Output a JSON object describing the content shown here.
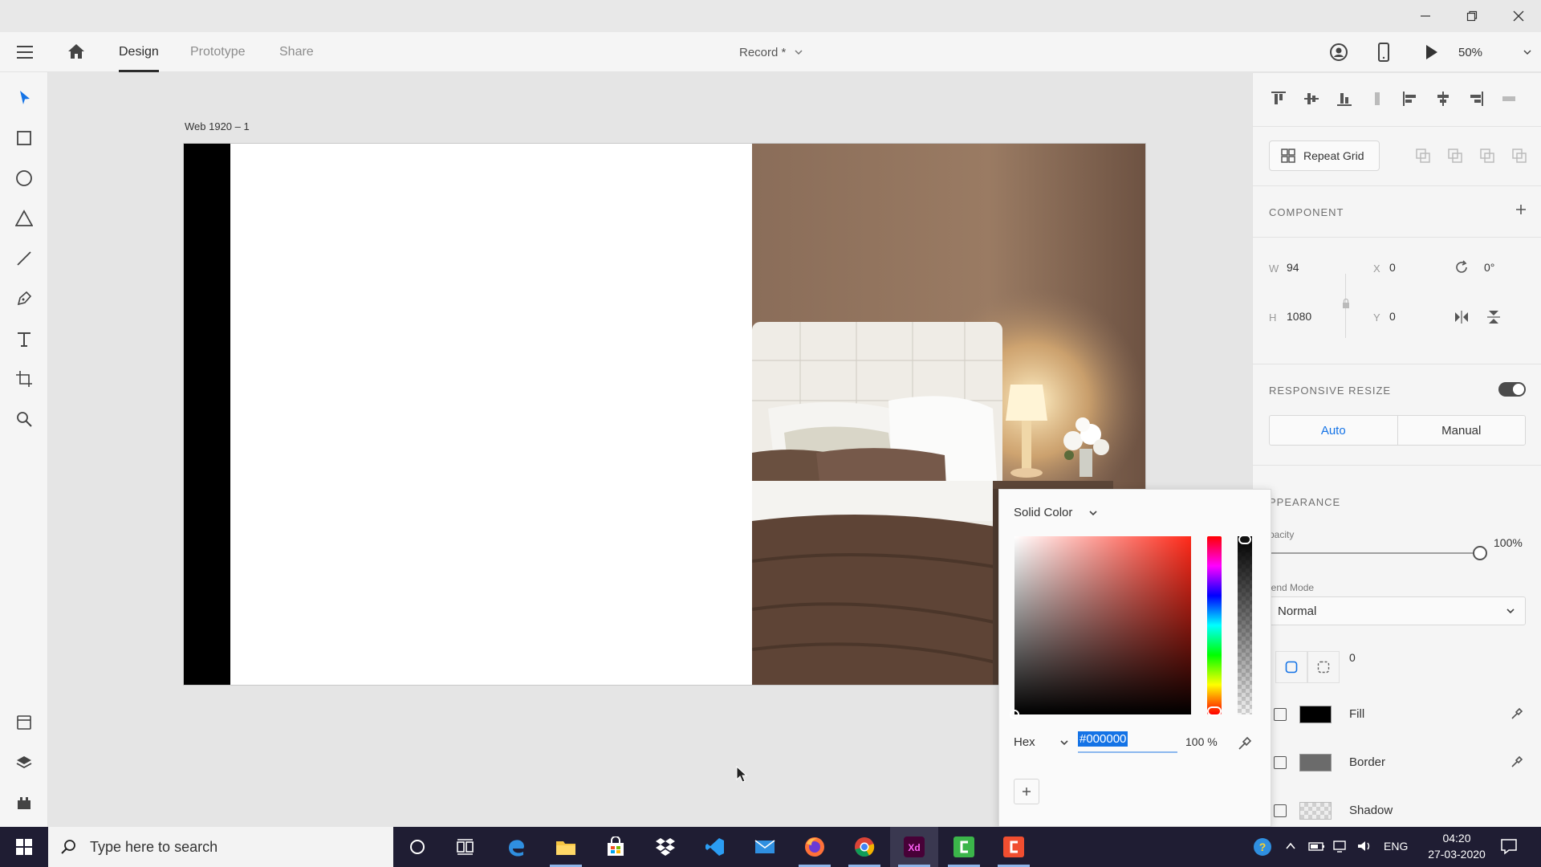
{
  "header": {
    "tabs": [
      {
        "label": "Design",
        "active": true
      },
      {
        "label": "Prototype",
        "active": false
      },
      {
        "label": "Share",
        "active": false
      }
    ],
    "document_title": "Record *",
    "zoom": "50%"
  },
  "canvas": {
    "artboard_name": "Web 1920 – 1"
  },
  "panel": {
    "repeat_grid_label": "Repeat Grid",
    "component_title": "COMPONENT",
    "transform": {
      "w_label": "W",
      "w_value": "94",
      "h_label": "H",
      "h_value": "1080",
      "x_label": "X",
      "x_value": "0",
      "y_label": "Y",
      "y_value": "0",
      "rotation_value": "0°"
    },
    "responsive_resize": {
      "title": "RESPONSIVE RESIZE",
      "enabled": true,
      "auto_label": "Auto",
      "manual_label": "Manual"
    },
    "appearance": {
      "title": "PPEARANCE",
      "opacity_label": "pacity",
      "opacity_value": "100%",
      "opacity_fraction": 1.0,
      "blend_label": "lend Mode",
      "blend_value": "Normal",
      "corner_radius": "0",
      "fill_label": "Fill",
      "fill_color": "#000000",
      "border_label": "Border",
      "border_color": "#6b6b6b",
      "shadow_label": "Shadow"
    }
  },
  "picker": {
    "mode": "Solid Color",
    "format": "Hex",
    "hex_value": "#000000",
    "alpha": "100 %",
    "hue_color": "#ff2a1a"
  },
  "taskbar": {
    "search_placeholder": "Type here to search",
    "language": "ENG",
    "time": "04:20",
    "date": "27-03-2020"
  },
  "colors": {
    "accent": "#1473e6",
    "taskbar": "#1f1d33"
  }
}
